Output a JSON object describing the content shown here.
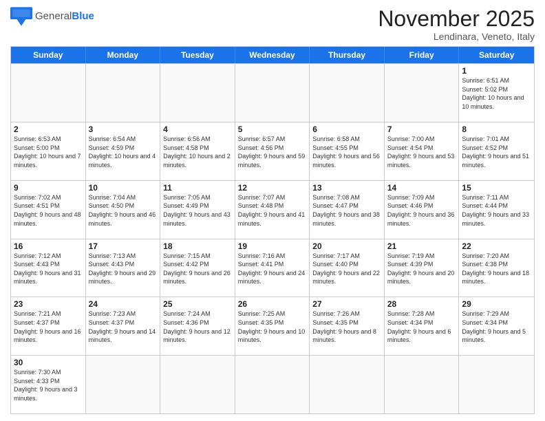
{
  "header": {
    "logo_general": "General",
    "logo_blue": "Blue",
    "month_title": "November 2025",
    "subtitle": "Lendinara, Veneto, Italy"
  },
  "weekdays": [
    "Sunday",
    "Monday",
    "Tuesday",
    "Wednesday",
    "Thursday",
    "Friday",
    "Saturday"
  ],
  "rows": [
    [
      {
        "day": "",
        "info": ""
      },
      {
        "day": "",
        "info": ""
      },
      {
        "day": "",
        "info": ""
      },
      {
        "day": "",
        "info": ""
      },
      {
        "day": "",
        "info": ""
      },
      {
        "day": "",
        "info": ""
      },
      {
        "day": "1",
        "info": "Sunrise: 6:51 AM\nSunset: 5:02 PM\nDaylight: 10 hours and 10 minutes."
      }
    ],
    [
      {
        "day": "2",
        "info": "Sunrise: 6:53 AM\nSunset: 5:00 PM\nDaylight: 10 hours and 7 minutes."
      },
      {
        "day": "3",
        "info": "Sunrise: 6:54 AM\nSunset: 4:59 PM\nDaylight: 10 hours and 4 minutes."
      },
      {
        "day": "4",
        "info": "Sunrise: 6:56 AM\nSunset: 4:58 PM\nDaylight: 10 hours and 2 minutes."
      },
      {
        "day": "5",
        "info": "Sunrise: 6:57 AM\nSunset: 4:56 PM\nDaylight: 9 hours and 59 minutes."
      },
      {
        "day": "6",
        "info": "Sunrise: 6:58 AM\nSunset: 4:55 PM\nDaylight: 9 hours and 56 minutes."
      },
      {
        "day": "7",
        "info": "Sunrise: 7:00 AM\nSunset: 4:54 PM\nDaylight: 9 hours and 53 minutes."
      },
      {
        "day": "8",
        "info": "Sunrise: 7:01 AM\nSunset: 4:52 PM\nDaylight: 9 hours and 51 minutes."
      }
    ],
    [
      {
        "day": "9",
        "info": "Sunrise: 7:02 AM\nSunset: 4:51 PM\nDaylight: 9 hours and 48 minutes."
      },
      {
        "day": "10",
        "info": "Sunrise: 7:04 AM\nSunset: 4:50 PM\nDaylight: 9 hours and 46 minutes."
      },
      {
        "day": "11",
        "info": "Sunrise: 7:05 AM\nSunset: 4:49 PM\nDaylight: 9 hours and 43 minutes."
      },
      {
        "day": "12",
        "info": "Sunrise: 7:07 AM\nSunset: 4:48 PM\nDaylight: 9 hours and 41 minutes."
      },
      {
        "day": "13",
        "info": "Sunrise: 7:08 AM\nSunset: 4:47 PM\nDaylight: 9 hours and 38 minutes."
      },
      {
        "day": "14",
        "info": "Sunrise: 7:09 AM\nSunset: 4:46 PM\nDaylight: 9 hours and 36 minutes."
      },
      {
        "day": "15",
        "info": "Sunrise: 7:11 AM\nSunset: 4:44 PM\nDaylight: 9 hours and 33 minutes."
      }
    ],
    [
      {
        "day": "16",
        "info": "Sunrise: 7:12 AM\nSunset: 4:43 PM\nDaylight: 9 hours and 31 minutes."
      },
      {
        "day": "17",
        "info": "Sunrise: 7:13 AM\nSunset: 4:43 PM\nDaylight: 9 hours and 29 minutes."
      },
      {
        "day": "18",
        "info": "Sunrise: 7:15 AM\nSunset: 4:42 PM\nDaylight: 9 hours and 26 minutes."
      },
      {
        "day": "19",
        "info": "Sunrise: 7:16 AM\nSunset: 4:41 PM\nDaylight: 9 hours and 24 minutes."
      },
      {
        "day": "20",
        "info": "Sunrise: 7:17 AM\nSunset: 4:40 PM\nDaylight: 9 hours and 22 minutes."
      },
      {
        "day": "21",
        "info": "Sunrise: 7:19 AM\nSunset: 4:39 PM\nDaylight: 9 hours and 20 minutes."
      },
      {
        "day": "22",
        "info": "Sunrise: 7:20 AM\nSunset: 4:38 PM\nDaylight: 9 hours and 18 minutes."
      }
    ],
    [
      {
        "day": "23",
        "info": "Sunrise: 7:21 AM\nSunset: 4:37 PM\nDaylight: 9 hours and 16 minutes."
      },
      {
        "day": "24",
        "info": "Sunrise: 7:23 AM\nSunset: 4:37 PM\nDaylight: 9 hours and 14 minutes."
      },
      {
        "day": "25",
        "info": "Sunrise: 7:24 AM\nSunset: 4:36 PM\nDaylight: 9 hours and 12 minutes."
      },
      {
        "day": "26",
        "info": "Sunrise: 7:25 AM\nSunset: 4:35 PM\nDaylight: 9 hours and 10 minutes."
      },
      {
        "day": "27",
        "info": "Sunrise: 7:26 AM\nSunset: 4:35 PM\nDaylight: 9 hours and 8 minutes."
      },
      {
        "day": "28",
        "info": "Sunrise: 7:28 AM\nSunset: 4:34 PM\nDaylight: 9 hours and 6 minutes."
      },
      {
        "day": "29",
        "info": "Sunrise: 7:29 AM\nSunset: 4:34 PM\nDaylight: 9 hours and 5 minutes."
      }
    ],
    [
      {
        "day": "30",
        "info": "Sunrise: 7:30 AM\nSunset: 4:33 PM\nDaylight: 9 hours and 3 minutes."
      },
      {
        "day": "",
        "info": ""
      },
      {
        "day": "",
        "info": ""
      },
      {
        "day": "",
        "info": ""
      },
      {
        "day": "",
        "info": ""
      },
      {
        "day": "",
        "info": ""
      },
      {
        "day": "",
        "info": ""
      }
    ]
  ]
}
